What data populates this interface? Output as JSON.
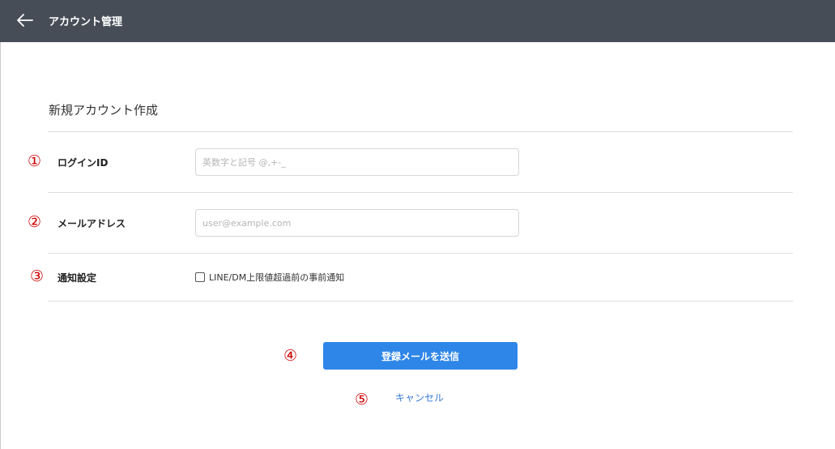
{
  "header": {
    "title": "アカウント管理",
    "back_icon": "arrow-left-icon"
  },
  "form": {
    "title": "新規アカウント作成",
    "markers": [
      "①",
      "②",
      "③",
      "④",
      "⑤"
    ],
    "login_id": {
      "label": "ログインID",
      "placeholder": "英数字と記号 @,+-_",
      "value": ""
    },
    "email": {
      "label": "メールアドレス",
      "placeholder": "user@example.com",
      "value": ""
    },
    "notification": {
      "label": "通知設定",
      "checkbox_label": "LINE/DM上限値超過前の事前通知",
      "checked": false
    },
    "submit_label": "登録メールを送信",
    "cancel_label": "キャンセル"
  },
  "colors": {
    "header_bg": "#474d57",
    "primary": "#2e86e8",
    "link": "#3a7bd5",
    "marker": "#cc0000"
  }
}
